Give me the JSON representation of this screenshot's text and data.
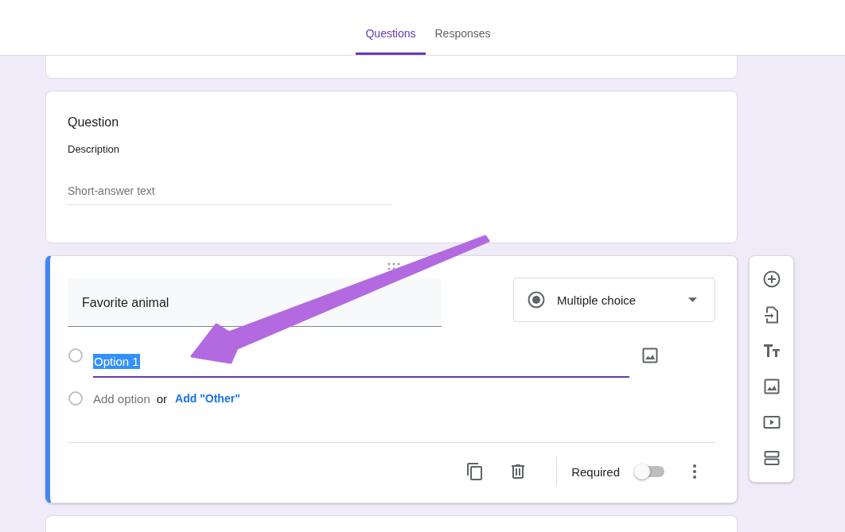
{
  "tabs": [
    {
      "label": "Questions",
      "selected": true
    },
    {
      "label": "Responses",
      "selected": false
    }
  ],
  "questions": [
    {
      "kind": "short",
      "title": "Question",
      "description": "Description",
      "placeholder": "Short-answer text"
    },
    {
      "kind": "choice",
      "focused": true,
      "title": "Favorite animal",
      "type": "Multiple choice",
      "options": [
        {
          "label": "Option 1",
          "highlighted": true
        }
      ],
      "add_option": "Add option",
      "or": "or",
      "add_other": "Add \"Other\"",
      "required_label": "Required",
      "required": false
    }
  ]
}
